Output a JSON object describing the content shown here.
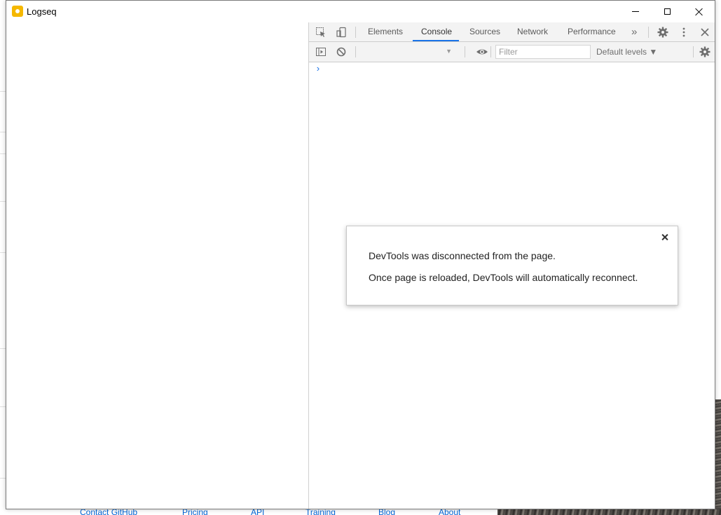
{
  "window": {
    "title": "Logseq"
  },
  "background": {
    "footer_links": [
      "Contact GitHub",
      "Pricing",
      "API",
      "Training",
      "Blog",
      "About"
    ]
  },
  "devtools": {
    "tabs": [
      {
        "label": "Elements",
        "active": false
      },
      {
        "label": "Console",
        "active": true
      },
      {
        "label": "Sources",
        "active": false
      },
      {
        "label": "Network",
        "active": false
      },
      {
        "label": "Performance",
        "active": false
      }
    ],
    "more_tabs_glyph": "»",
    "toolbar": {
      "filter_placeholder": "Filter",
      "levels_label": "Default levels ▼"
    },
    "console_prompt": "›",
    "accent_color": "#1a73e8"
  },
  "dialog": {
    "line1": "DevTools was disconnected from the page.",
    "line2": "Once page is reloaded, DevTools will automatically reconnect."
  }
}
